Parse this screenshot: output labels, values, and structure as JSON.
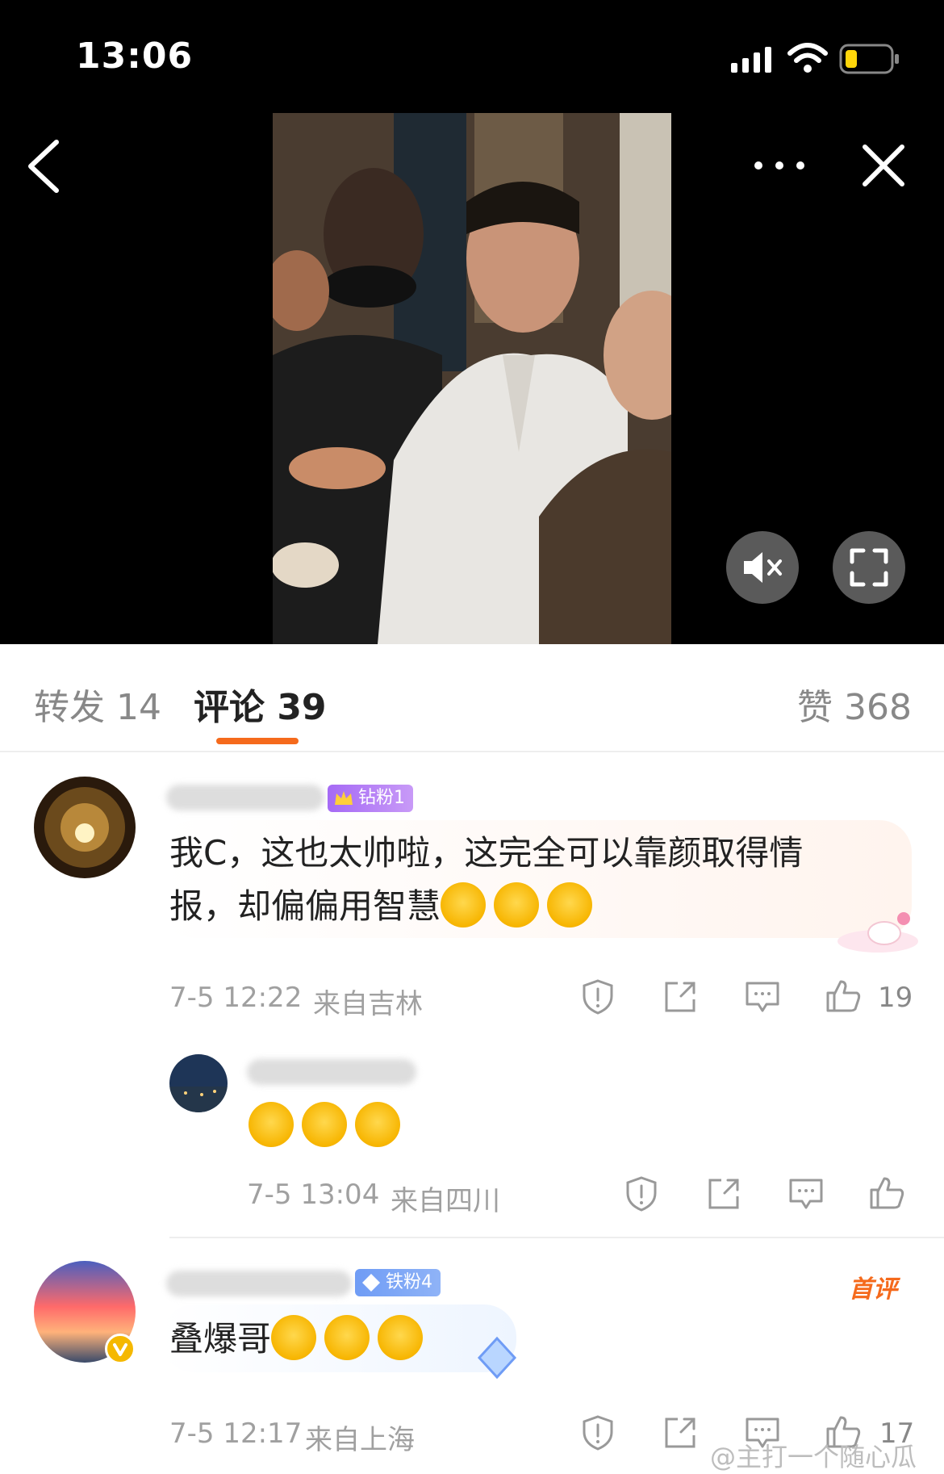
{
  "status_bar": {
    "time": "13:06"
  },
  "video": {
    "is_muted": true
  },
  "tabs": [
    {
      "label": "转发 14",
      "active": false
    },
    {
      "label": "评论 39",
      "active": true
    },
    {
      "label": "赞 368",
      "active": false
    }
  ],
  "comments": [
    {
      "badge": "钻粉1",
      "badge_level": "6",
      "text": "我C，这也太帅啦，这完全可以靠颜取得情报，却偏偏用智慧",
      "emoji_count": 3,
      "time": "7-5 12:22",
      "location": "来自吉林",
      "likes": "19",
      "reply": {
        "emoji_count": 3,
        "time": "7-5 13:04",
        "location": "来自四川"
      }
    },
    {
      "badge": "铁粉4",
      "first_label": "首评",
      "text": "叠爆哥",
      "emoji_count": 3,
      "time": "7-5 12:17",
      "location": "来自上海",
      "likes": "17"
    }
  ],
  "watermark": "@主打一个随心瓜",
  "colors": {
    "accent": "#f56a1c",
    "diamond_badge": "#b36bf0",
    "iron_badge": "#6f9cf5"
  }
}
